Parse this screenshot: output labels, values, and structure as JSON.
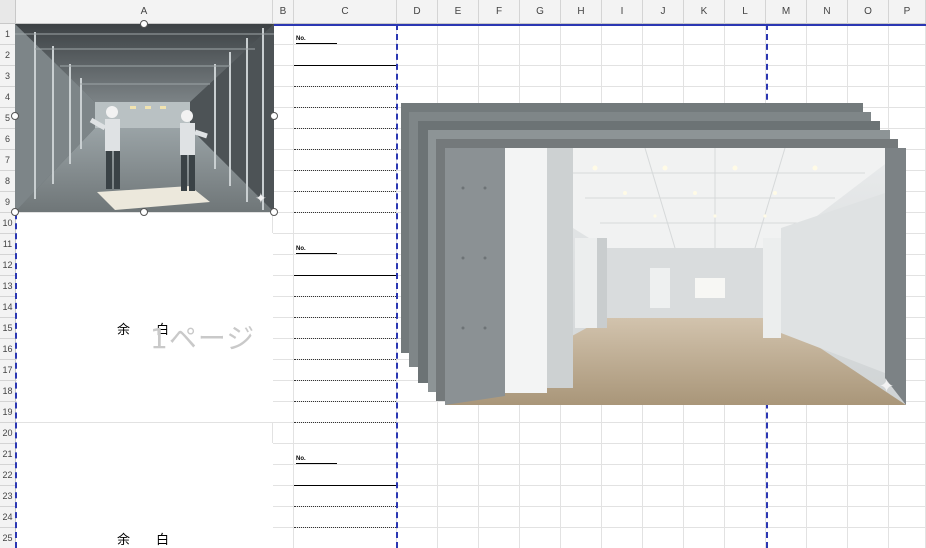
{
  "columns": [
    "A",
    "B",
    "C",
    "D",
    "E",
    "F",
    "G",
    "H",
    "I",
    "J",
    "K",
    "L",
    "M",
    "N",
    "O",
    "P"
  ],
  "rows": [
    "1",
    "2",
    "3",
    "4",
    "5",
    "6",
    "7",
    "8",
    "9",
    "10",
    "11",
    "12",
    "13",
    "14",
    "15",
    "16",
    "17",
    "18",
    "19",
    "20",
    "21",
    "22",
    "23",
    "24",
    "25"
  ],
  "blocks": [
    {
      "no_label": "No."
    },
    {
      "no_label": "No.",
      "yohaku": "余白"
    },
    {
      "no_label": "No.",
      "yohaku": "余白"
    }
  ],
  "watermark": "1ページ",
  "images": [
    {
      "name": "construction-workers-photo",
      "icon": "sparkle-icon"
    },
    {
      "name": "office-interior-photo",
      "icon": "sparkle-icon"
    }
  ],
  "colors": {
    "page_break": "#2b37b3",
    "grid": "#e2e2e2",
    "header_bg": "#f3f3f3"
  }
}
